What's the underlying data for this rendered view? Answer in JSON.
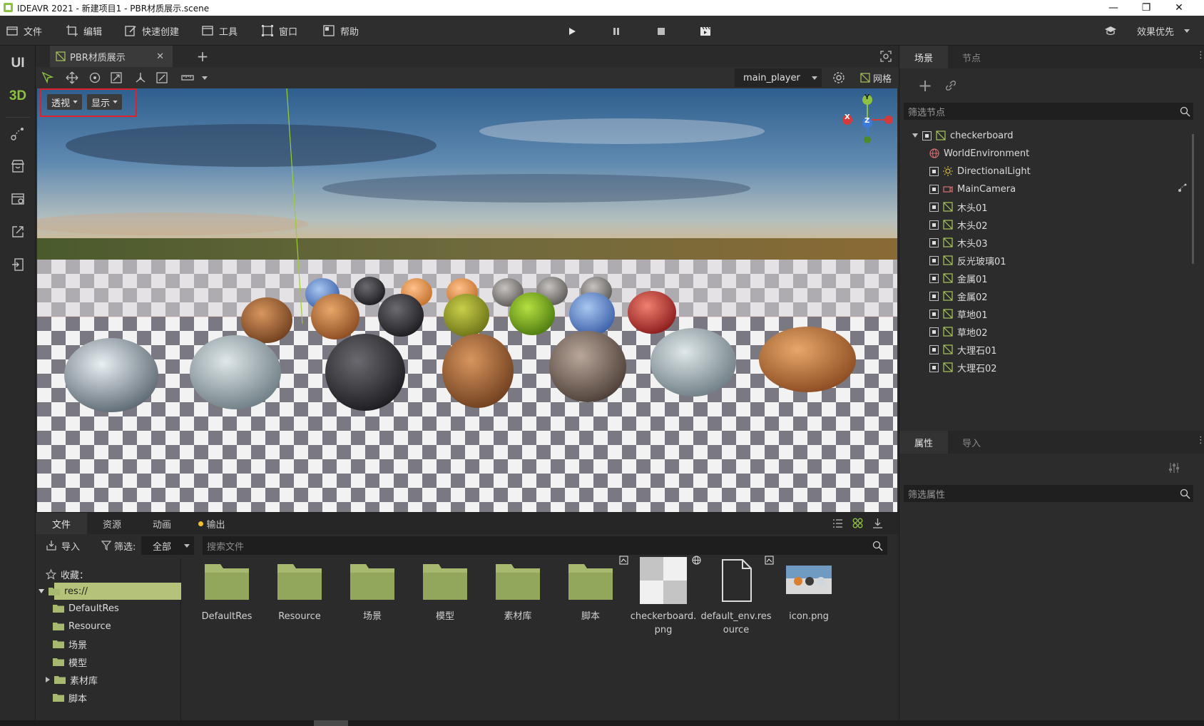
{
  "window": {
    "title": "IDEAVR 2021 - 新建项目1 - PBR材质展示.scene",
    "controls": [
      "minimize-icon",
      "restore-icon",
      "close-icon"
    ]
  },
  "menubar": {
    "items": [
      {
        "label": "文件",
        "icon": "file-icon"
      },
      {
        "label": "编辑",
        "icon": "edit-crop-icon"
      },
      {
        "label": "快速创建",
        "icon": "quick-create-icon"
      },
      {
        "label": "工具",
        "icon": "tools-icon"
      },
      {
        "label": "窗口",
        "icon": "window-icon"
      },
      {
        "label": "帮助",
        "icon": "help-icon"
      }
    ],
    "playback": [
      "play-icon",
      "pause-icon",
      "stop-icon",
      "clapperboard-icon"
    ],
    "quality_label": "效果优先"
  },
  "left_rail": {
    "modes": [
      "UI",
      "3D"
    ],
    "accent_3d": "#8cc23f",
    "icons": [
      "path-icon",
      "store-icon",
      "package-icon",
      "export-icon",
      "import-icon"
    ]
  },
  "scene_tabs": {
    "tabs": [
      {
        "label": "PBR材质展示"
      }
    ]
  },
  "viewport_toolbar": {
    "player": "main_player",
    "grid_label": "网格"
  },
  "viewport": {
    "perspective_label": "透视",
    "display_label": "显示",
    "gizmo": {
      "x": "X",
      "y": "Y",
      "z": "Z"
    }
  },
  "scene_panel": {
    "tabs": [
      "场景",
      "节点"
    ],
    "filter_placeholder": "筛选节点",
    "tree": [
      {
        "label": "checkerboard"
      },
      {
        "label": "WorldEnvironment"
      },
      {
        "label": "DirectionalLight"
      },
      {
        "label": "MainCamera"
      },
      {
        "label": "木头01"
      },
      {
        "label": "木头02"
      },
      {
        "label": "木头03"
      },
      {
        "label": "反光玻璃01"
      },
      {
        "label": "金属01"
      },
      {
        "label": "金属02"
      },
      {
        "label": "草地01"
      },
      {
        "label": "草地02"
      },
      {
        "label": "大理石01"
      },
      {
        "label": "大理石02"
      }
    ]
  },
  "property_panel": {
    "tabs": [
      "属性",
      "导入"
    ],
    "filter_placeholder": "筛选属性"
  },
  "bottom_panel": {
    "tabs": [
      "文件",
      "资源",
      "动画",
      "输出"
    ],
    "output_dot_color": "#f0c030",
    "import_label": "导入",
    "filter_label": "筛选:",
    "filter_value": "全部",
    "search_placeholder": "搜索文件",
    "favorites_label": "收藏：",
    "tree": [
      {
        "label": "res://"
      },
      {
        "label": "DefaultRes"
      },
      {
        "label": "Resource"
      },
      {
        "label": "场景"
      },
      {
        "label": "模型"
      },
      {
        "label": "素材库"
      },
      {
        "label": "脚本"
      }
    ],
    "files": [
      {
        "name": "DefaultRes",
        "type": "folder"
      },
      {
        "name": "Resource",
        "type": "folder"
      },
      {
        "name": "场景",
        "type": "folder"
      },
      {
        "name": "模型",
        "type": "folder"
      },
      {
        "name": "素材库",
        "type": "folder"
      },
      {
        "name": "脚本",
        "type": "folder"
      },
      {
        "name": "checkerboard.png",
        "type": "image"
      },
      {
        "name": "default_env.resource",
        "type": "file"
      },
      {
        "name": "icon.png",
        "type": "image"
      }
    ],
    "folder_color": "#a7b96f"
  }
}
